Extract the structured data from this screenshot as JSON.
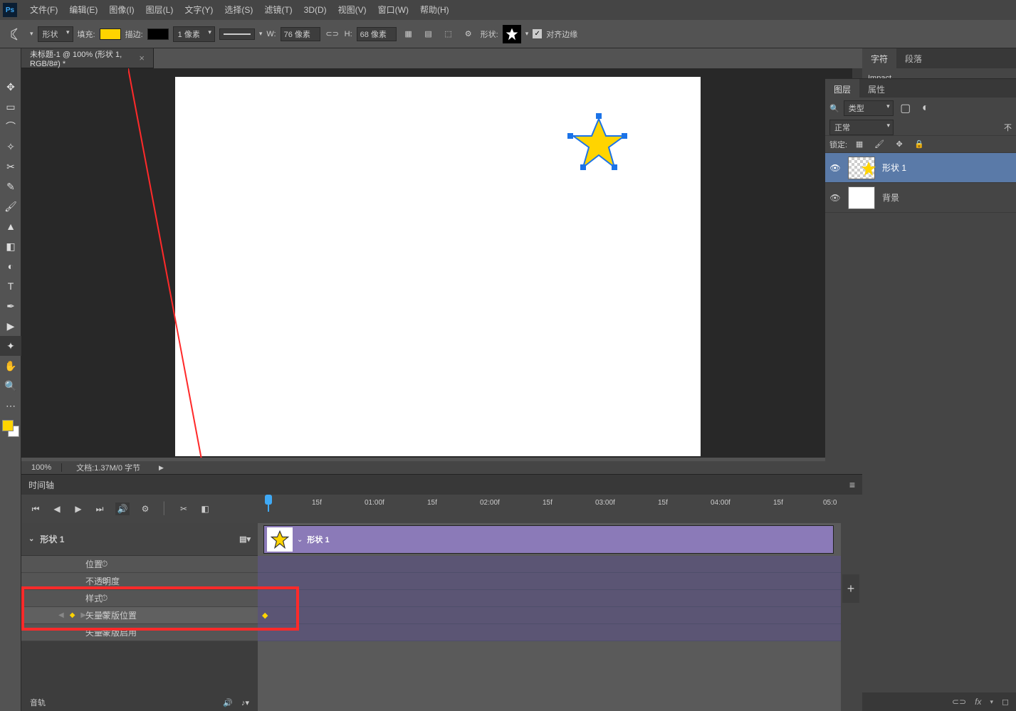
{
  "menu": {
    "items": [
      "文件(F)",
      "编辑(E)",
      "图像(I)",
      "图层(L)",
      "文字(Y)",
      "选择(S)",
      "滤镜(T)",
      "3D(D)",
      "视图(V)",
      "窗口(W)",
      "帮助(H)"
    ]
  },
  "optbar": {
    "shapeMode": "形状",
    "fillLabel": "填充:",
    "strokeLabel": "描边:",
    "strokeWidth": "1 像素",
    "wLabel": "W:",
    "wVal": "76 像素",
    "hLabel": "H:",
    "hVal": "68 像素",
    "shapeLabel": "形状:",
    "alignLabel": "对齐边缘"
  },
  "doctab": {
    "title": "未标题-1 @ 100% (形状 1, RGB/8#) *"
  },
  "status": {
    "zoom": "100%",
    "doc": "文档:1.37M/0 字节"
  },
  "charPanel": {
    "tab1": "字符",
    "tab2": "段落",
    "font": "Impact"
  },
  "layersPanel": {
    "tab1": "图层",
    "tab2": "属性",
    "filterKind": "类型",
    "blend": "正常",
    "opLabel": "不",
    "lockLabel": "锁定:",
    "layers": [
      {
        "name": "形状 1",
        "selected": true
      },
      {
        "name": "背景",
        "selected": false
      }
    ]
  },
  "timeline": {
    "title": "时间轴",
    "layerName": "形状 1",
    "clipName": "形状 1",
    "props": [
      "位置",
      "不透明度",
      "样式",
      "矢量蒙版位置",
      "矢量蒙版启用"
    ],
    "audio": "音轨",
    "ticks": [
      "15f",
      "01:00f",
      "15f",
      "02:00f",
      "15f",
      "03:00f",
      "15f",
      "04:00f",
      "15f",
      "05:0"
    ]
  },
  "colors": {
    "fill": "#ffd400",
    "accent": "#8b7ab8",
    "highlight": "#ff2a2a"
  }
}
